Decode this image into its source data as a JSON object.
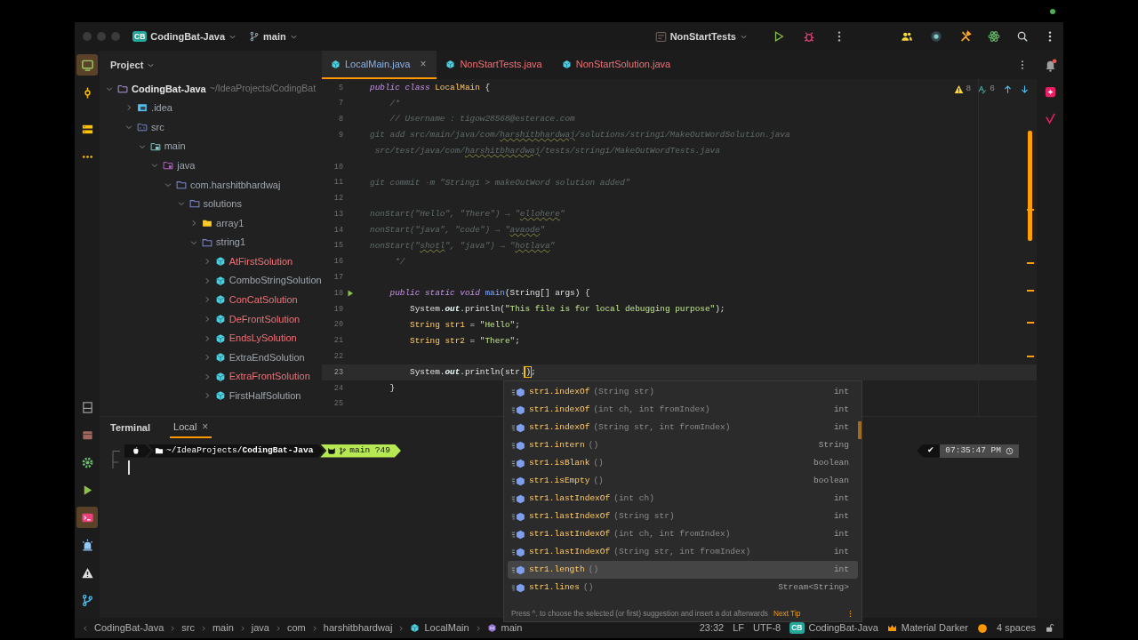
{
  "window": {
    "project_badge": "CB",
    "project": "CodingBat-Java",
    "branch": "main",
    "run_config": "NonStartTests"
  },
  "tool_strip": {
    "top": [
      {
        "kind": "project",
        "selected": true
      },
      {
        "kind": "commit",
        "selected": false
      },
      {
        "kind": "structure",
        "selected": false
      },
      {
        "kind": "more",
        "selected": false
      }
    ],
    "bottom": [
      {
        "kind": "bookmarks",
        "selected": false
      },
      {
        "kind": "build",
        "selected": false
      },
      {
        "kind": "services",
        "selected": false
      },
      {
        "kind": "run",
        "selected": false
      },
      {
        "kind": "terminal",
        "selected": true
      },
      {
        "kind": "alarm",
        "selected": false
      },
      {
        "kind": "problems",
        "selected": false
      },
      {
        "kind": "git",
        "selected": false
      }
    ]
  },
  "right_strip": [
    {
      "kind": "notifications",
      "alert": true
    },
    {
      "kind": "ai",
      "alert": false
    },
    {
      "kind": "review",
      "alert": false
    }
  ],
  "project_panel": {
    "title": "Project",
    "tree": [
      {
        "label": "CodingBat-Java",
        "path": "~/IdeaProjects/CodingBat",
        "kind": "module",
        "expanded": true,
        "children": [
          {
            "label": ".idea",
            "kind": "config",
            "expanded": false
          },
          {
            "label": "src",
            "kind": "source",
            "expanded": true,
            "children": [
              {
                "label": "main",
                "kind": "folder",
                "expanded": true,
                "children": [
                  {
                    "label": "java",
                    "kind": "root",
                    "expanded": true,
                    "children": [
                      {
                        "label": "com.harshitbhardwaj",
                        "kind": "package",
                        "expanded": true,
                        "children": [
                          {
                            "label": "solutions",
                            "kind": "package",
                            "expanded": true,
                            "children": [
                              {
                                "label": "array1",
                                "kind": "yellow-folder",
                                "expanded": false
                              },
                              {
                                "label": "string1",
                                "kind": "package",
                                "expanded": true,
                                "children": [
                                  {
                                    "label": "AtFirstSolution",
                                    "kind": "class",
                                    "expanded": false,
                                    "color": "#f07178"
                                  },
                                  {
                                    "label": "ComboStringSolution",
                                    "kind": "class",
                                    "expanded": false,
                                    "color": "#9ea6ae"
                                  },
                                  {
                                    "label": "ConCatSolution",
                                    "kind": "class",
                                    "expanded": false,
                                    "color": "#f07178"
                                  },
                                  {
                                    "label": "DeFrontSolution",
                                    "kind": "class",
                                    "expanded": false,
                                    "color": "#f07178"
                                  },
                                  {
                                    "label": "EndsLySolution",
                                    "kind": "class",
                                    "expanded": false,
                                    "color": "#f07178"
                                  },
                                  {
                                    "label": "ExtraEndSolution",
                                    "kind": "class",
                                    "expanded": false,
                                    "color": "#9ea6ae"
                                  },
                                  {
                                    "label": "ExtraFrontSolution",
                                    "kind": "class",
                                    "expanded": false,
                                    "color": "#f07178"
                                  },
                                  {
                                    "label": "FirstHalfSolution",
                                    "kind": "class",
                                    "expanded": false,
                                    "color": "#9ea6ae"
                                  }
                                ]
                              }
                            ]
                          }
                        ]
                      }
                    ]
                  }
                ]
              }
            ]
          }
        ]
      }
    ]
  },
  "editor": {
    "tabs": [
      {
        "label": "LocalMain.java",
        "selected": true,
        "color": "#8fb4e6",
        "close": "×"
      },
      {
        "label": "NonStartTests.java",
        "selected": false,
        "color": "#f07178"
      },
      {
        "label": "NonStartSolution.java",
        "selected": false,
        "color": "#f07178"
      }
    ],
    "inspections": {
      "warnings": "8",
      "typos": "6"
    },
    "lines": [
      {
        "num": "5",
        "current": false,
        "segments": [
          {
            "kind": "keyword",
            "text": "public class "
          },
          {
            "kind": "type",
            "text": "LocalMain"
          },
          {
            "kind": "plain",
            "text": " {"
          }
        ]
      },
      {
        "num": "7",
        "current": false,
        "segments": [
          {
            "kind": "comment",
            "text": "    /*"
          }
        ]
      },
      {
        "num": "8",
        "current": false,
        "segments": [
          {
            "kind": "comment",
            "text": "    // Username : tigow28568@esterace.com"
          }
        ]
      },
      {
        "num": "9",
        "current": false,
        "segments": [
          {
            "kind": "comment",
            "text": "git add src/main/java/com/"
          },
          {
            "kind": "typo",
            "text": "harshitbhardwaj"
          },
          {
            "kind": "comment",
            "text": "/solutions/string1/MakeOutWordSolution.java"
          }
        ]
      },
      {
        "segments": [
          {
            "kind": "comment",
            "text": " src/test/java/com/"
          },
          {
            "kind": "typo",
            "text": "harshitbhardwaj"
          },
          {
            "kind": "comment",
            "text": "/tests/string1/MakeOutWordTests.java"
          }
        ]
      },
      {
        "num": "10",
        "current": false
      },
      {
        "num": "11",
        "current": false,
        "segments": [
          {
            "kind": "comment",
            "text": "git commit -m \"String1 > makeOutWord solution added\""
          }
        ]
      },
      {
        "num": "12",
        "current": false
      },
      {
        "num": "13",
        "current": false,
        "segments": [
          {
            "kind": "comment",
            "text": "nonStart(\"Hello\", \"There\") → \""
          },
          {
            "kind": "typo",
            "text": "ellohere"
          },
          {
            "kind": "comment",
            "text": "\""
          }
        ]
      },
      {
        "num": "14",
        "current": false,
        "segments": [
          {
            "kind": "comment",
            "text": "nonStart(\"java\", \"code\") → \""
          },
          {
            "kind": "typo",
            "text": "avaode"
          },
          {
            "kind": "comment",
            "text": "\""
          }
        ]
      },
      {
        "num": "15",
        "current": false,
        "segments": [
          {
            "kind": "comment",
            "text": "nonStart(\""
          },
          {
            "kind": "typo",
            "text": "shotl"
          },
          {
            "kind": "comment",
            "text": "\", \"java\") → \""
          },
          {
            "kind": "typo",
            "text": "hotlava"
          },
          {
            "kind": "comment",
            "text": "\""
          }
        ]
      },
      {
        "num": "16",
        "current": false,
        "segments": [
          {
            "kind": "comment",
            "text": "     */"
          }
        ]
      },
      {
        "num": "17",
        "current": false
      },
      {
        "num": "18",
        "current": false,
        "runnable": true,
        "segments": [
          {
            "kind": "keyword",
            "text": "    public static void "
          },
          {
            "kind": "method",
            "text": "main"
          },
          {
            "kind": "plain",
            "text": "(String[] args) {"
          }
        ]
      },
      {
        "num": "19",
        "current": false,
        "segments": [
          {
            "kind": "plain",
            "text": "        System."
          },
          {
            "kind": "field",
            "text": "out"
          },
          {
            "kind": "plain",
            "text": ".println("
          },
          {
            "kind": "string",
            "text": "\"This file is for local debugging purpose\""
          },
          {
            "kind": "plain",
            "text": ");"
          }
        ]
      },
      {
        "num": "20",
        "current": false,
        "segments": [
          {
            "kind": "type",
            "text": "        String str1"
          },
          {
            "kind": "plain",
            "text": " = "
          },
          {
            "kind": "string",
            "text": "\"Hello\""
          },
          {
            "kind": "plain",
            "text": ";"
          }
        ]
      },
      {
        "num": "21",
        "current": false,
        "segments": [
          {
            "kind": "type",
            "text": "        String str2"
          },
          {
            "kind": "plain",
            "text": " = "
          },
          {
            "kind": "string",
            "text": "\"There\""
          },
          {
            "kind": "plain",
            "text": ";"
          }
        ]
      },
      {
        "num": "22",
        "current": false
      },
      {
        "num": "23",
        "current": true,
        "segments": [
          {
            "kind": "plain",
            "text": "        System."
          },
          {
            "kind": "field",
            "text": "out"
          },
          {
            "kind": "plain",
            "text": ".println(str."
          },
          {
            "kind": "caret-match",
            "text": ")"
          },
          {
            "kind": "plain",
            "text": ";"
          }
        ]
      },
      {
        "num": "24",
        "current": false,
        "segments": [
          {
            "kind": "plain",
            "text": "    }"
          }
        ]
      },
      {
        "num": "25",
        "current": false
      }
    ]
  },
  "completion": {
    "items": [
      {
        "name": "str1.indexOf",
        "params": "(String str)",
        "type": "int",
        "selected": false
      },
      {
        "name": "str1.indexOf",
        "params": "(int ch, int fromIndex)",
        "type": "int",
        "selected": false
      },
      {
        "name": "str1.indexOf",
        "params": "(String str, int fromIndex)",
        "type": "int",
        "selected": false
      },
      {
        "name": "str1.intern",
        "params": "()",
        "type": "String",
        "selected": false
      },
      {
        "name": "str1.isBlank",
        "params": "()",
        "type": "boolean",
        "selected": false
      },
      {
        "name": "str1.isEmpty",
        "params": "()",
        "type": "boolean",
        "selected": false
      },
      {
        "name": "str1.lastIndexOf",
        "params": "(int ch)",
        "type": "int",
        "selected": false
      },
      {
        "name": "str1.lastIndexOf",
        "params": "(String str)",
        "type": "int",
        "selected": false
      },
      {
        "name": "str1.lastIndexOf",
        "params": "(int ch, int fromIndex)",
        "type": "int",
        "selected": false
      },
      {
        "name": "str1.lastIndexOf",
        "params": "(String str, int fromIndex)",
        "type": "int",
        "selected": false
      },
      {
        "name": "str1.length",
        "params": "()",
        "type": "int",
        "selected": true
      },
      {
        "name": "str1.lines",
        "params": "()",
        "type": "Stream<String>",
        "selected": false
      }
    ],
    "hint": "Press ^. to choose the selected (or first) suggestion and insert a dot afterwards",
    "next_tip": "Next Tip"
  },
  "terminal": {
    "title": "Terminal",
    "tabs": [
      {
        "label": "Local",
        "selected": true,
        "close": "×"
      }
    ],
    "prompt": {
      "path": "~/IdeaProjects/**CodingBat-Java**",
      "git": "main ?49",
      "status": "✔",
      "time": "07:35:47 PM"
    }
  },
  "status_bar": {
    "breadcrumbs": [
      {
        "kind": "folder",
        "label": "CodingBat-Java"
      },
      {
        "kind": "folder",
        "label": "src"
      },
      {
        "kind": "folder",
        "label": "main"
      },
      {
        "kind": "folder",
        "label": "java"
      },
      {
        "kind": "folder",
        "label": "com"
      },
      {
        "kind": "folder",
        "label": "harshitbhardwaj"
      },
      {
        "kind": "class",
        "label": "LocalMain"
      },
      {
        "kind": "method",
        "label": "main"
      }
    ],
    "position": "23:32",
    "line_separator": "LF",
    "encoding": "UTF-8",
    "project_badge": "CB",
    "project": "CodingBat-Java",
    "theme": "Material Darker",
    "indent": "4 spaces"
  }
}
